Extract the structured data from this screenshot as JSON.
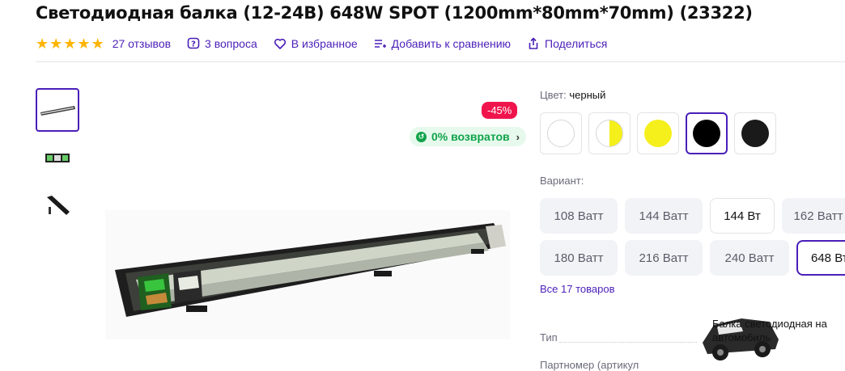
{
  "product": {
    "title": "Светодиодная балка (12-24В) 648W SPOT (1200mm*80mm*70mm) (23322)"
  },
  "meta": {
    "rating_stars": 5,
    "reviews": "27 отзывов",
    "questions": "3 вопроса",
    "favorites": "В избранное",
    "compare": "Добавить к сравнению",
    "share": "Поделиться"
  },
  "gallery": {
    "discount": "-45%",
    "returns": "0% возвратов"
  },
  "color": {
    "label": "Цвет:",
    "value": "черный",
    "swatches": [
      {
        "color": "#ffffff",
        "style": "white"
      },
      {
        "color": "#f5ef1c",
        "style": "half-white-yellow"
      },
      {
        "color": "#f5ef1c",
        "style": "yellow"
      },
      {
        "color": "#000000",
        "style": "black",
        "selected": true
      },
      {
        "color": "#1a1a1a",
        "style": "black"
      }
    ]
  },
  "variant": {
    "label": "Вариант:",
    "options": [
      "108 Ватт",
      "144 Ватт",
      "144 Вт",
      "162 Ватт",
      "180 Ватт",
      "216 Ватт",
      "240 Ватт",
      "648 Вт"
    ],
    "selected": "648 Вт",
    "all_link": "Все 17 товаров"
  },
  "specs": {
    "type_label": "Тип",
    "type_value": "Балка светодиодная на автомобиль",
    "part_label": "Партномер (артикул"
  },
  "colors": {
    "accent": "#4a1fb8",
    "discount": "#f0144c",
    "returns_bg": "#e6f9ec",
    "returns_fg": "#10a34a",
    "star": "#ffb400"
  }
}
